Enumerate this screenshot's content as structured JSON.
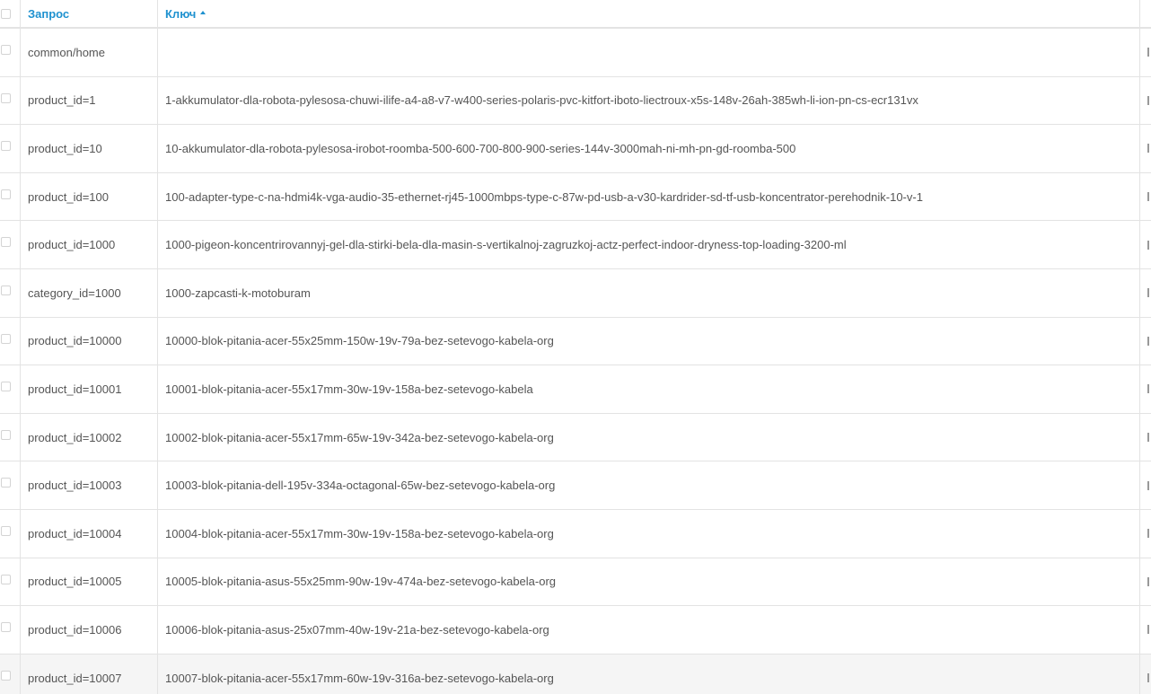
{
  "table": {
    "header": {
      "query_label": "Запрос",
      "key_label": "Ключ"
    },
    "rows": [
      {
        "query": "common/home",
        "key": ""
      },
      {
        "query": "product_id=1",
        "key": "1-akkumulator-dla-robota-pylesosa-chuwi-ilife-a4-a8-v7-w400-series-polaris-pvc-kitfort-iboto-liectroux-x5s-148v-26ah-385wh-li-ion-pn-cs-ecr131vx"
      },
      {
        "query": "product_id=10",
        "key": "10-akkumulator-dla-robota-pylesosa-irobot-roomba-500-600-700-800-900-series-144v-3000mah-ni-mh-pn-gd-roomba-500"
      },
      {
        "query": "product_id=100",
        "key": "100-adapter-type-c-na-hdmi4k-vga-audio-35-ethernet-rj45-1000mbps-type-c-87w-pd-usb-a-v30-kardrider-sd-tf-usb-koncentrator-perehodnik-10-v-1"
      },
      {
        "query": "product_id=1000",
        "key": "1000-pigeon-koncentrirovannyj-gel-dla-stirki-bela-dla-masin-s-vertikalnoj-zagruzkoj-actz-perfect-indoor-dryness-top-loading-3200-ml"
      },
      {
        "query": "category_id=1000",
        "key": "1000-zapcasti-k-motoburam"
      },
      {
        "query": "product_id=10000",
        "key": "10000-blok-pitania-acer-55x25mm-150w-19v-79a-bez-setevogo-kabela-org"
      },
      {
        "query": "product_id=10001",
        "key": "10001-blok-pitania-acer-55x17mm-30w-19v-158a-bez-setevogo-kabela"
      },
      {
        "query": "product_id=10002",
        "key": "10002-blok-pitania-acer-55x17mm-65w-19v-342a-bez-setevogo-kabela-org"
      },
      {
        "query": "product_id=10003",
        "key": "10003-blok-pitania-dell-195v-334a-octagonal-65w-bez-setevogo-kabela-org"
      },
      {
        "query": "product_id=10004",
        "key": "10004-blok-pitania-acer-55x17mm-30w-19v-158a-bez-setevogo-kabela-org"
      },
      {
        "query": "product_id=10005",
        "key": "10005-blok-pitania-asus-55x25mm-90w-19v-474a-bez-setevogo-kabela-org"
      },
      {
        "query": "product_id=10006",
        "key": "10006-blok-pitania-asus-25x07mm-40w-19v-21a-bez-setevogo-kabela-org"
      },
      {
        "query": "product_id=10007",
        "key": "10007-blok-pitania-acer-55x17mm-60w-19v-316a-bez-setevogo-kabela-org"
      }
    ]
  },
  "colors": {
    "link": "#1e91cf",
    "border": "#e3e3e3",
    "text": "#555555",
    "hover_row": "#f5f5f5"
  }
}
